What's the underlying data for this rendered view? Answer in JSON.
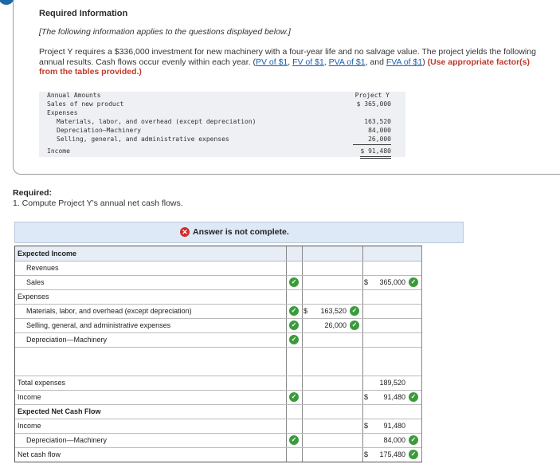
{
  "header": {
    "title": "Required Information",
    "note": "[The following information applies to the questions displayed below.]",
    "paragraph_before": "Project Y requires a $336,000 investment for new machinery with a four-year life and no salvage value. The project yields the following annual results. Cash flows occur evenly within each year. (",
    "links": [
      "PV of $1",
      "FV of $1",
      "PVA of $1",
      "FVA of $1"
    ],
    "paragraph_red": "(Use appropriate factor(s) from the tables provided.)"
  },
  "annual_table": {
    "heading_left": "Annual Amounts",
    "heading_right": "Project Y",
    "rows": [
      {
        "label": "Sales of new product",
        "value": "$ 365,000"
      },
      {
        "label": "Expenses",
        "value": ""
      },
      {
        "label": "Materials, labor, and overhead (except depreciation)",
        "value": "163,520"
      },
      {
        "label": "Depreciation—Machinery",
        "value": "84,000"
      },
      {
        "label": "Selling, general, and administrative expenses",
        "value": "26,000"
      },
      {
        "label": "Income",
        "value": "$ 91,480"
      }
    ]
  },
  "question": {
    "label": "Required:",
    "text": "1. Compute Project Y's annual net cash flows."
  },
  "answer": {
    "status": "Answer is not complete."
  },
  "grid": {
    "expected_income": "Expected Income",
    "revenues": "Revenues",
    "sales": "Sales",
    "sales_dollar": "$",
    "sales_value": "365,000",
    "expenses": "Expenses",
    "materials": "Materials, labor, and overhead (except depreciation)",
    "materials_dollar": "$",
    "materials_value": "163,520",
    "sga": "Selling, general, and administrative expenses",
    "sga_value": "26,000",
    "depreciation": "Depreciation—Machinery",
    "total_expenses": "Total expenses",
    "total_expenses_value": "189,520",
    "income": "Income",
    "income_dollar": "$",
    "income_value": "91,480",
    "expected_net_cash_flow": "Expected Net Cash Flow",
    "income2": "Income",
    "income2_dollar": "$",
    "income2_value": "91,480",
    "depreciation2": "Depreciation—Machinery",
    "depreciation2_value": "84,000",
    "net_cash_flow": "Net cash flow",
    "net_cash_flow_dollar": "$",
    "net_cash_flow_value": "175,480"
  },
  "colors": {
    "check": "#3a9b3a",
    "error": "#d22a2a",
    "link": "#1a5fb4",
    "emphasis": "#c0392b",
    "answer_bar": "#dde9f7"
  },
  "icons": [
    "x-circle-icon",
    "check-circle-icon"
  ]
}
